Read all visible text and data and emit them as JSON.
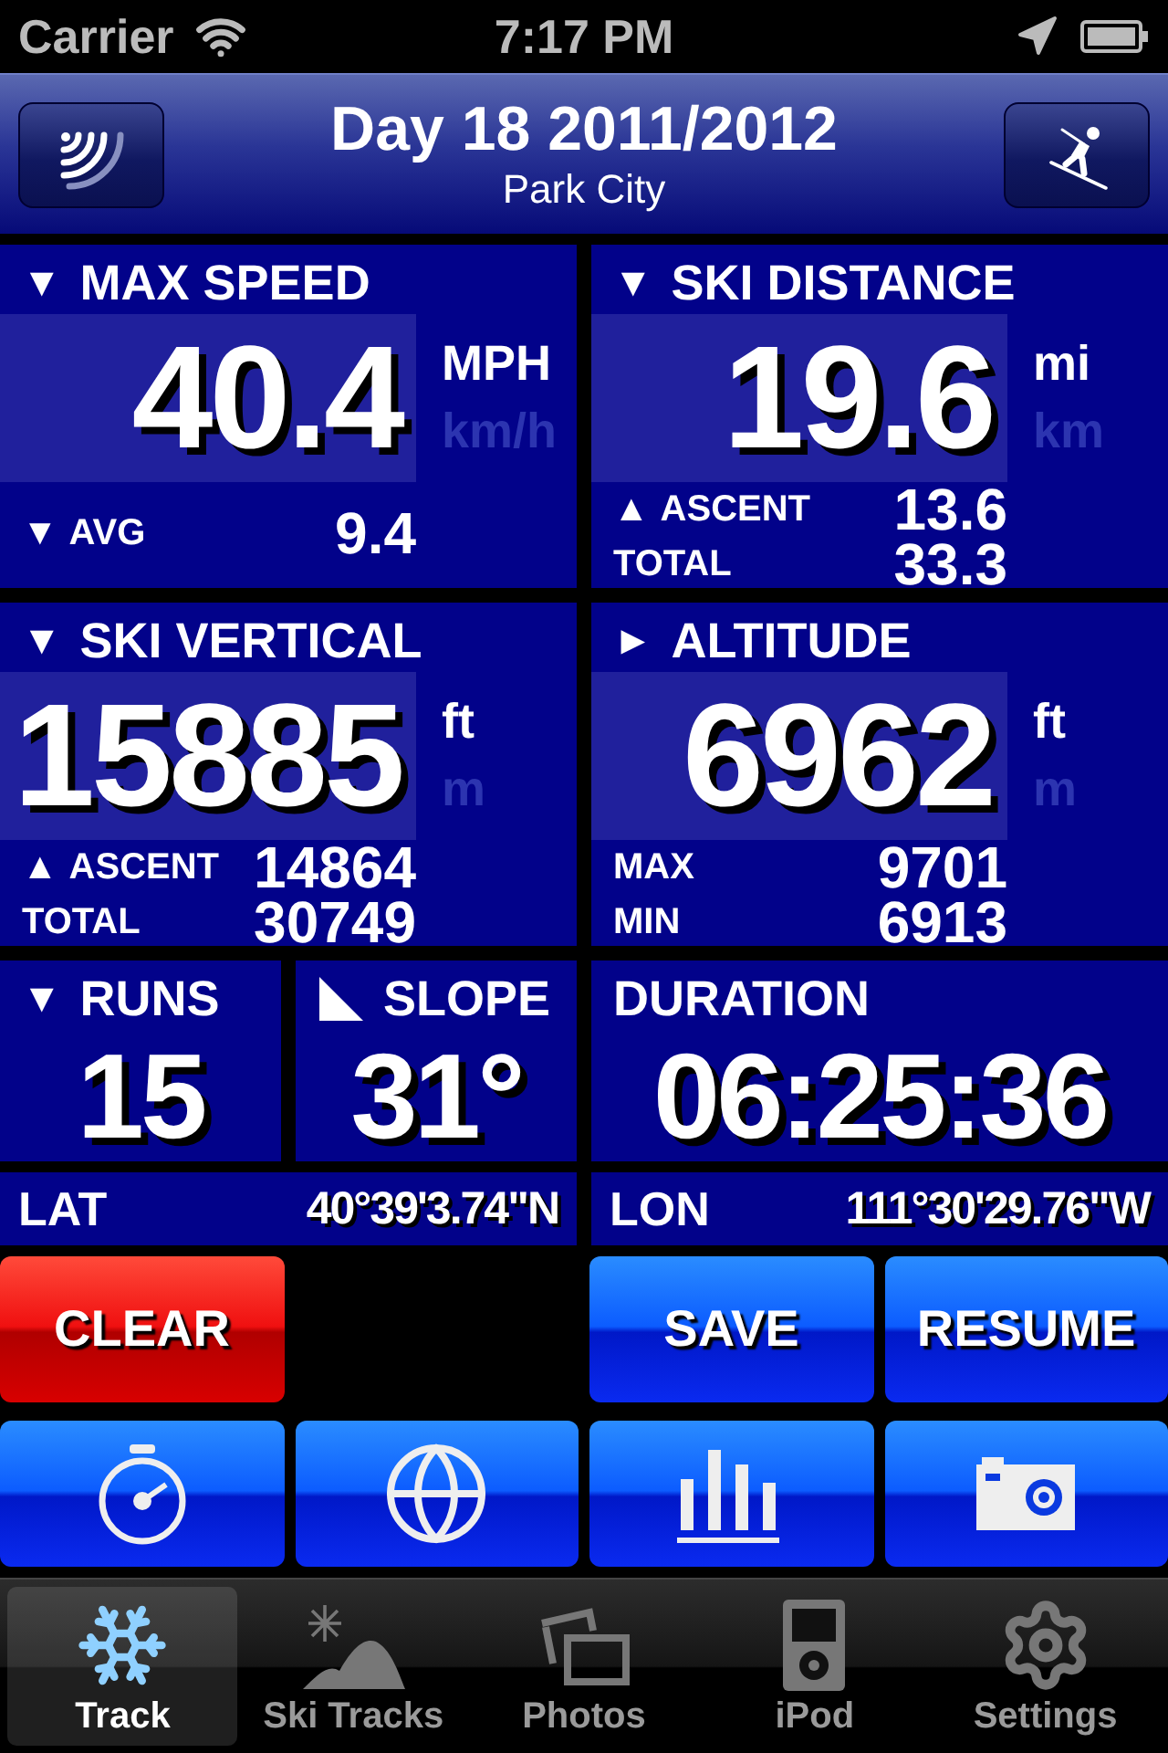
{
  "status_bar": {
    "carrier": "Carrier",
    "time": "7:17 PM"
  },
  "nav": {
    "title": "Day 18 2011/2012",
    "subtitle": "Park City"
  },
  "panels": [
    {
      "arrow": "▼",
      "label": "MAX SPEED",
      "value": "40.4",
      "units": [
        {
          "label": "MPH",
          "selected": true
        },
        {
          "label": "km/h",
          "selected": false
        }
      ],
      "rows": [
        {
          "arrow": "▼",
          "label": "AVG",
          "value": "9.4"
        }
      ]
    },
    {
      "arrow": "▼",
      "label": "SKI DISTANCE",
      "value": "19.6",
      "units": [
        {
          "label": "mi",
          "selected": true
        },
        {
          "label": "km",
          "selected": false
        }
      ],
      "rows": [
        {
          "arrow": "▲",
          "label": "ASCENT",
          "value": "13.6"
        },
        {
          "label": "TOTAL",
          "value": "33.3"
        }
      ]
    },
    {
      "arrow": "▼",
      "label": "SKI VERTICAL",
      "value": "15885",
      "units": [
        {
          "label": "ft",
          "selected": true
        },
        {
          "label": "m",
          "selected": false
        }
      ],
      "rows": [
        {
          "arrow": "▲",
          "label": "ASCENT",
          "value": "14864"
        },
        {
          "label": "TOTAL",
          "value": "30749"
        }
      ]
    },
    {
      "arrow": "►",
      "label": "ALTITUDE",
      "value": "6962",
      "units": [
        {
          "label": "ft",
          "selected": true
        },
        {
          "label": "m",
          "selected": false
        }
      ],
      "rows": [
        {
          "label": "MAX",
          "value": "9701"
        },
        {
          "label": "MIN",
          "value": "6913"
        }
      ]
    }
  ],
  "small_panels": [
    {
      "kind": "count",
      "arrow": "▼",
      "label": "RUNS",
      "value": "15"
    },
    {
      "kind": "slope",
      "label": "SLOPE",
      "value": "31°"
    }
  ],
  "duration": {
    "label": "DURATION",
    "value": "06:25:36"
  },
  "coords": [
    {
      "label": "LAT",
      "value": "40°39'3.74\"N"
    },
    {
      "label": "LON",
      "value": "111°30'29.76\"W"
    }
  ],
  "actions": [
    {
      "label": "CLEAR",
      "kind": "danger"
    },
    {
      "kind": "spacer"
    },
    {
      "label": "SAVE",
      "kind": "primary"
    },
    {
      "label": "RESUME",
      "kind": "primary"
    }
  ],
  "tabs": [
    {
      "label": "Track",
      "selected": true
    },
    {
      "label": "Ski Tracks",
      "selected": false
    },
    {
      "label": "Photos",
      "selected": false
    },
    {
      "label": "iPod",
      "selected": false
    },
    {
      "label": "Settings",
      "selected": false
    }
  ]
}
